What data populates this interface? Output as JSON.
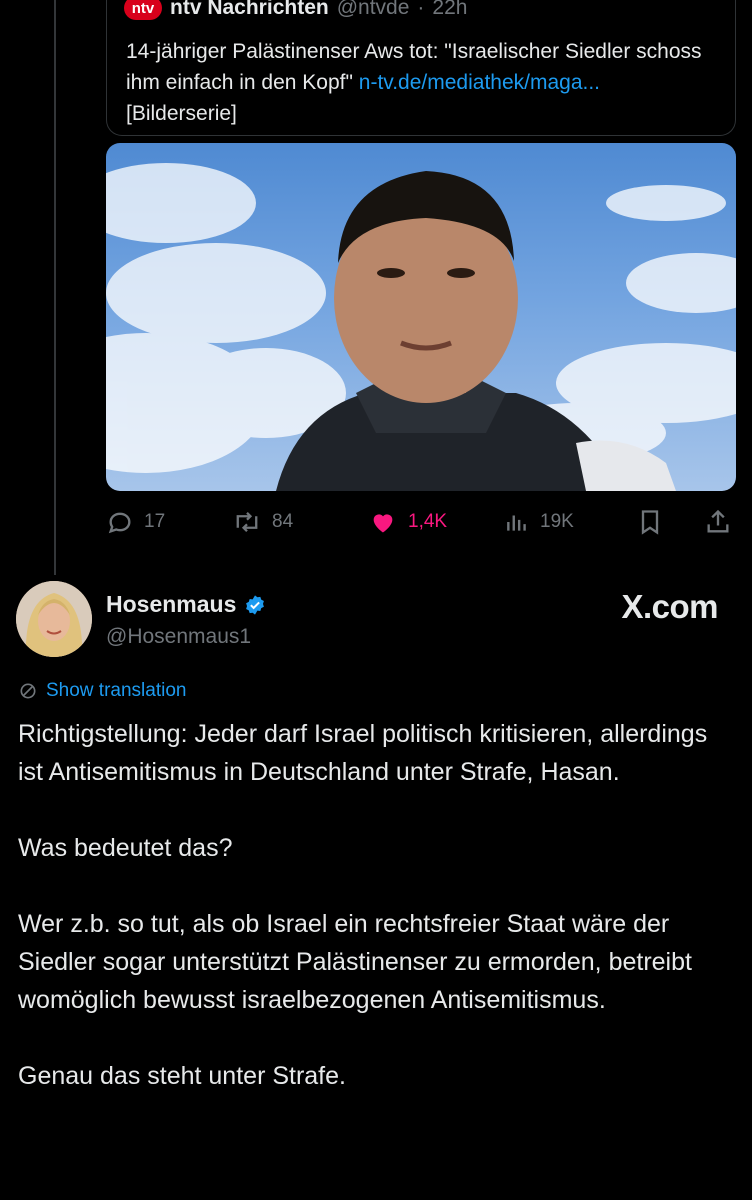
{
  "quoted_tweet": {
    "logo": "ntv",
    "author": "ntv Nachrichten",
    "handle": "@ntvde",
    "separator": "·",
    "time": "22h",
    "text": "14-jähriger Palästinenser Aws tot: \"Israelischer Siedler schoss ihm einfach in den Kopf\" ",
    "link": "n-tv.de/mediathek/maga...",
    "suffix": "  [Bilderserie]"
  },
  "actions": {
    "replies": "17",
    "reposts": "84",
    "likes": "1,4K",
    "views": "19K",
    "liked_color": "#f91880"
  },
  "post": {
    "author_name": "Hosenmaus",
    "handle": "@Hosenmaus1",
    "verified": true,
    "watermark": "X.com",
    "show_translation": "Show translation",
    "paragraphs": [
      "Richtigstellung: Jeder darf Israel politisch kritisieren, allerdings ist Antisemitismus in Deutschland unter Strafe, Hasan.",
      "Was bedeutet das?",
      "Wer z.b. so tut, als ob Israel ein rechtsfreier Staat wäre der Siedler sogar unterstützt Palästinenser zu ermorden, betreibt womöglich bewusst israelbezogenen Antisemitismus.",
      "Genau das steht unter Strafe."
    ]
  },
  "colors": {
    "background": "#000000",
    "text": "#e7e9ea",
    "muted": "#71767b",
    "link": "#1d9bf0",
    "verified": "#1d9bf0"
  }
}
